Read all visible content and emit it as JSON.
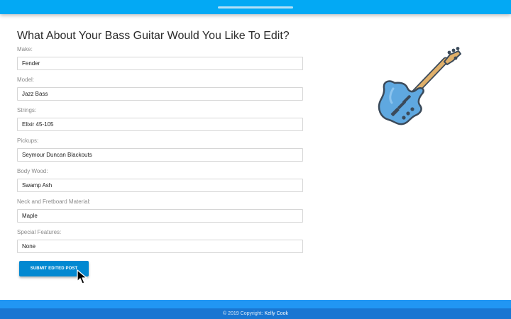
{
  "form": {
    "title": "What About Your Bass Guitar Would You Like To Edit?",
    "fields": [
      {
        "label": "Make:",
        "value": "Fender"
      },
      {
        "label": "Model:",
        "value": "Jazz Bass"
      },
      {
        "label": "Strings:",
        "value": "Elixir 45-105"
      },
      {
        "label": "Pickups:",
        "value": "Seymour Duncan Blackouts"
      },
      {
        "label": "Body Wood:",
        "value": "Swamp Ash"
      },
      {
        "label": "Neck and Fretboard Material:",
        "value": "Maple"
      },
      {
        "label": "Special Features:",
        "value": "None"
      }
    ],
    "submit_label": "SUBMIT EDITED POST"
  },
  "illustration": {
    "icon": "bass-guitar-icon",
    "body_color": "#5fa8e0",
    "neck_color": "#e0b06a"
  },
  "footer": {
    "copyright": "© 2019 Copyright:",
    "author": "Kelly Cook"
  },
  "colors": {
    "header": "#03a9f4",
    "button": "#0288d1",
    "footer_top": "#2196f3",
    "footer_bottom": "#1976d2"
  }
}
